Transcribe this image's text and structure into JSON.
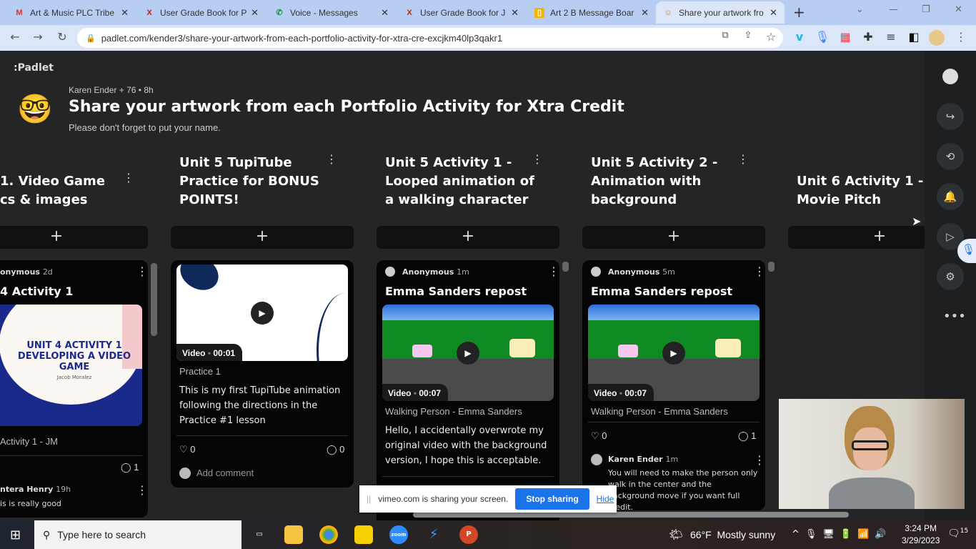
{
  "browser": {
    "tabs": [
      {
        "title": "Art & Music PLC Tribe",
        "icon": "gmail-icon",
        "color": "#d93025",
        "glyph": "M"
      },
      {
        "title": "User Grade Book for P",
        "icon": "gradebook-icon",
        "color": "#b3261e",
        "glyph": "X"
      },
      {
        "title": "Voice - Messages",
        "icon": "voice-icon",
        "color": "#1e8e3e",
        "glyph": "✆"
      },
      {
        "title": "User Grade Book for J",
        "icon": "gradebook-icon",
        "color": "#b3261e",
        "glyph": "X"
      },
      {
        "title": "Art 2 B Message Boar",
        "icon": "slides-icon",
        "color": "#f4b400",
        "glyph": "▯"
      },
      {
        "title": "Share your artwork fro",
        "icon": "padlet-icon",
        "color": "#e8b34a",
        "glyph": "☺"
      }
    ],
    "new_tab": "+",
    "url": "padlet.com/kender3/share-your-artwork-from-each-portfolio-activity-for-xtra-cre-excjkm40lp3qakr1"
  },
  "padlet": {
    "logo": ":Padlet",
    "author": "Karen Ender",
    "contributors": "+ 76",
    "age": "• 8h",
    "emoji": "🤓",
    "title": "Share your artwork from each Portfolio Activity for Xtra Credit",
    "description": "Please don't forget to put your name.",
    "columns": [
      {
        "title": "1. Video Game\ncs & images"
      },
      {
        "title": "Unit 5 TupiTube Practice for BONUS POINTS!"
      },
      {
        "title": "Unit 5 Activity 1 - Looped animation of a walking character"
      },
      {
        "title": "Unit 5 Activity 2 - Animation with background"
      },
      {
        "title": "Unit 6 Activity 1 - Movie Pitch"
      }
    ],
    "add": "+",
    "cards": {
      "c0": {
        "author": "onymous",
        "time": "2d",
        "title": "4 Activity 1",
        "image_text": "UNIT 4 ACTIVITY 1 DEVELOPING A VIDEO GAME",
        "image_sub": "Jacob Moralez",
        "caption": "Activity 1 - JM",
        "comments": "1",
        "commenter": "ntera Henry",
        "ctime": "19h",
        "comment": "is is really good"
      },
      "c1": {
        "video": "Video",
        "dur": "00:01",
        "caption": "Practice 1",
        "body": "This is my first TupiTube animation following the directions in the Practice #1 lesson",
        "likes": "0",
        "comments": "0",
        "add_comment": "Add comment"
      },
      "c2": {
        "author": "Anonymous",
        "time": "1m",
        "title": "Emma Sanders repost",
        "video": "Video",
        "dur": "00:07",
        "caption": "Walking Person - Emma Sanders",
        "body": "Hello, I accidentally overwrote my original video with the background version, I hope this is acceptable."
      },
      "c3": {
        "author": "Anonymous",
        "time": "5m",
        "title": "Emma Sanders repost",
        "video": "Video",
        "dur": "00:07",
        "caption": "Walking Person - Emma Sanders",
        "likes": "0",
        "comments": "1",
        "commenter": "Karen Ender",
        "ctime": "1m",
        "comment": "You will need to make the person only walk in the center and the background move if you want full credit."
      }
    }
  },
  "share_bar": {
    "text": "vimeo.com is sharing your screen.",
    "stop": "Stop sharing",
    "hide": "Hide"
  },
  "taskbar": {
    "search": "Type here to search",
    "weather": "66°F  Mostly sunny",
    "time": "3:24 PM",
    "date": "3/29/2023",
    "notifications": "15"
  }
}
